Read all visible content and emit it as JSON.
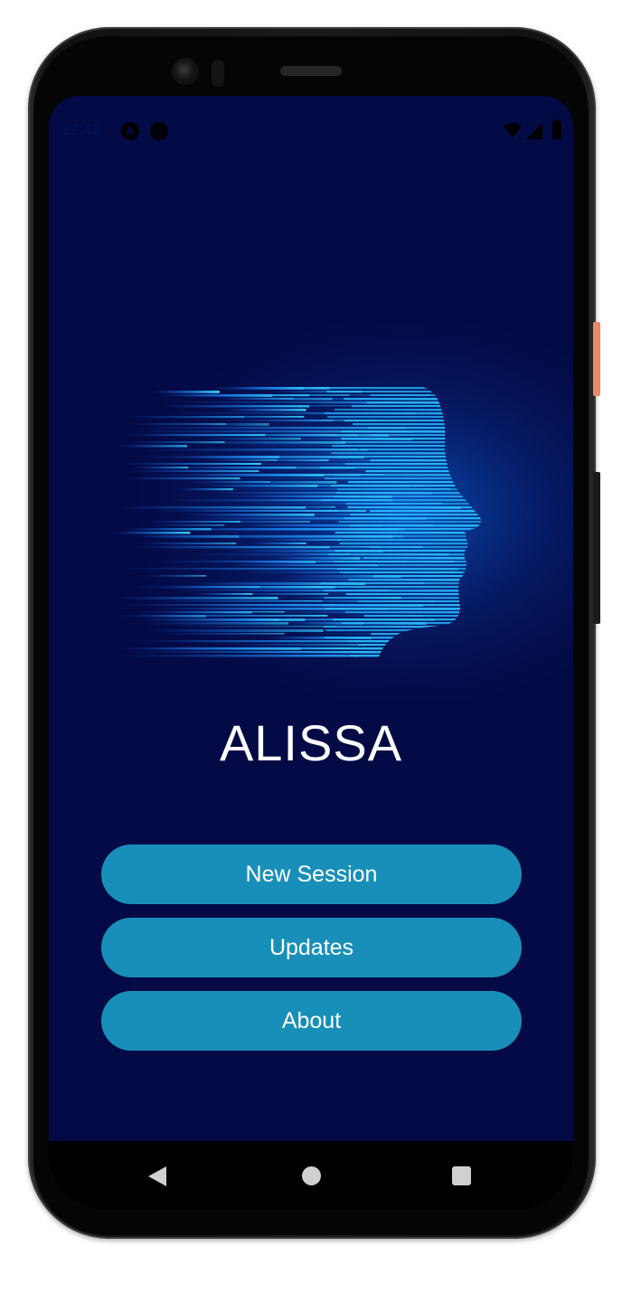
{
  "status_bar": {
    "time": "12:43",
    "icons": [
      "auto-icon",
      "vpn-icon",
      "wifi-icon",
      "signal-icon",
      "battery-icon"
    ]
  },
  "app": {
    "title": "ALISSA",
    "hero_image": "ai-face-icon",
    "background_color": "#030a45",
    "accent_color": "#188fb8"
  },
  "menu": {
    "new_session": "New Session",
    "updates": "Updates",
    "about": "About"
  },
  "nav_bar": {
    "icons": [
      "back-icon",
      "home-icon",
      "recents-icon"
    ]
  }
}
